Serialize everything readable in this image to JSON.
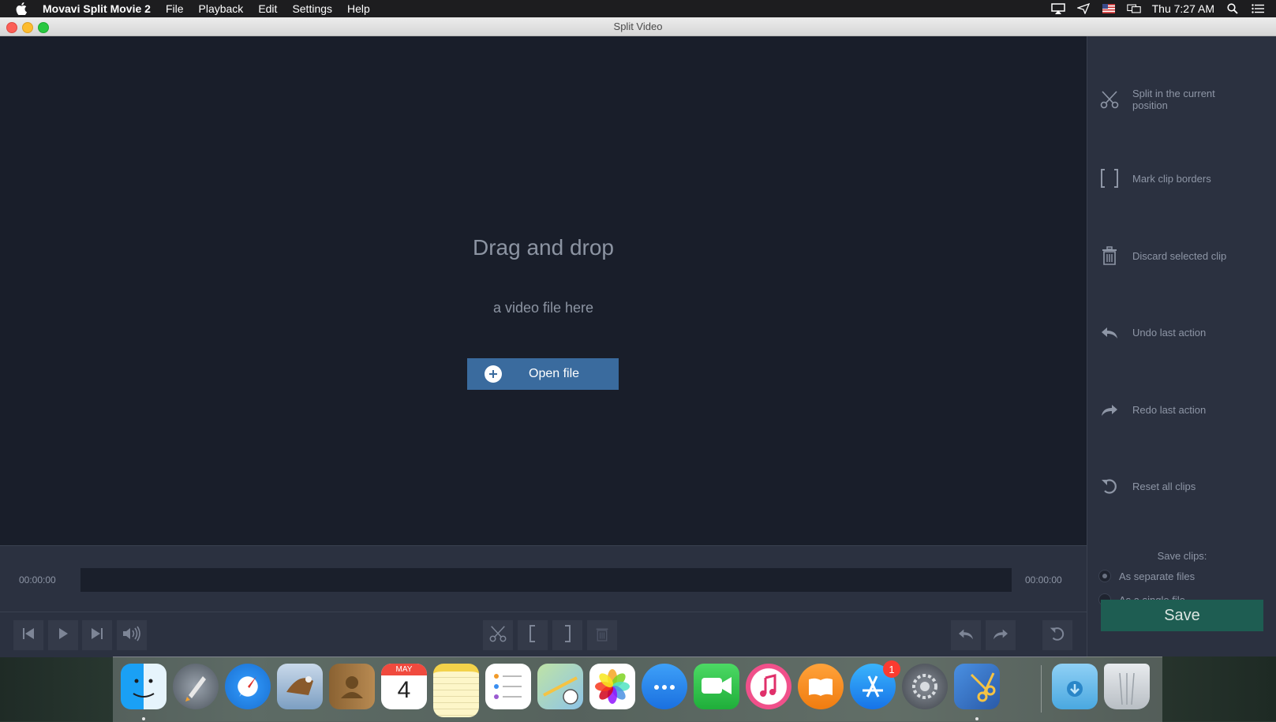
{
  "menubar": {
    "app_name": "Movavi Split Movie 2",
    "menus": [
      "File",
      "Playback",
      "Edit",
      "Settings",
      "Help"
    ],
    "clock": "Thu 7:27 AM"
  },
  "window": {
    "title": "Split Video"
  },
  "preview": {
    "drag_title": "Drag and drop",
    "drag_subtitle": "a video file here",
    "open_file_label": "Open file"
  },
  "sidebar": {
    "actions": [
      {
        "label": "Split in the current position",
        "icon": "scissors-icon"
      },
      {
        "label": "Mark clip borders",
        "icon": "brackets-icon"
      },
      {
        "label": "Discard selected clip",
        "icon": "trash-icon"
      },
      {
        "label": "Undo last action",
        "icon": "undo-icon"
      },
      {
        "label": "Redo last action",
        "icon": "redo-icon"
      },
      {
        "label": "Reset all clips",
        "icon": "reset-icon"
      }
    ],
    "save_title": "Save clips:",
    "options": [
      {
        "label": "As separate files",
        "selected": true
      },
      {
        "label": "As a single file",
        "selected": false
      }
    ],
    "save_label": "Save"
  },
  "timeline": {
    "start_time": "00:00:00",
    "end_time": "00:00:00"
  },
  "dock": {
    "calendar_month": "MAY",
    "calendar_day": "4",
    "appstore_badge": "1"
  },
  "colors": {
    "accent_blue": "#3a6b9e",
    "save_green": "#1e5d52",
    "panel": "#2b3140",
    "preview_bg": "#191e2a"
  }
}
